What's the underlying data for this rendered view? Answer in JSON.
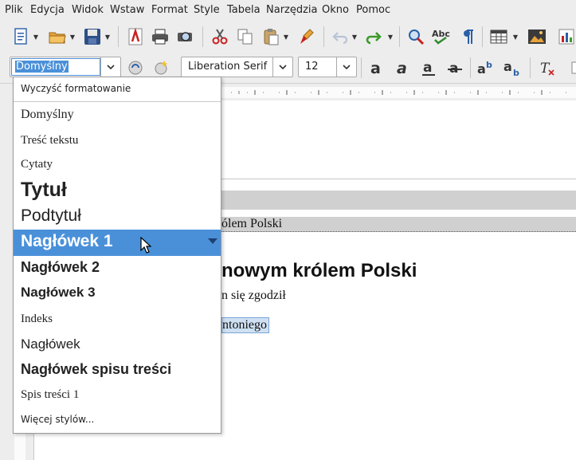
{
  "menu": [
    "Plik",
    "Edycja",
    "Widok",
    "Wstaw",
    "Format",
    "Style",
    "Tabela",
    "Narzędzia",
    "Okno",
    "Pomoc"
  ],
  "toolbar": {
    "style_box_value": "Domyślny",
    "font_name": "Liberation Serif",
    "font_size": "12",
    "spellcheck_label": "Abc"
  },
  "style_list": {
    "clear": "Wyczyść formatowanie",
    "items": [
      "Domyślny",
      "Treść tekstu",
      "Cytaty",
      "Tytuł",
      "Podtytuł",
      "Nagłówek 1",
      "Nagłówek 2",
      "Nagłówek 3",
      "Indeks",
      "Nagłówek",
      "Nagłówek spisu treści",
      "Spis treści 1"
    ],
    "more": "Więcej stylów..."
  },
  "document": {
    "toc_entry": "ólem Polski",
    "heading": "nowym królem Polski",
    "body_line": "n się zgodził",
    "field": "ntoniego"
  },
  "colors": {
    "selection": "#4a90d9",
    "toolbar_bg": "#ededed",
    "doc_shade": "#d0d0d0"
  }
}
